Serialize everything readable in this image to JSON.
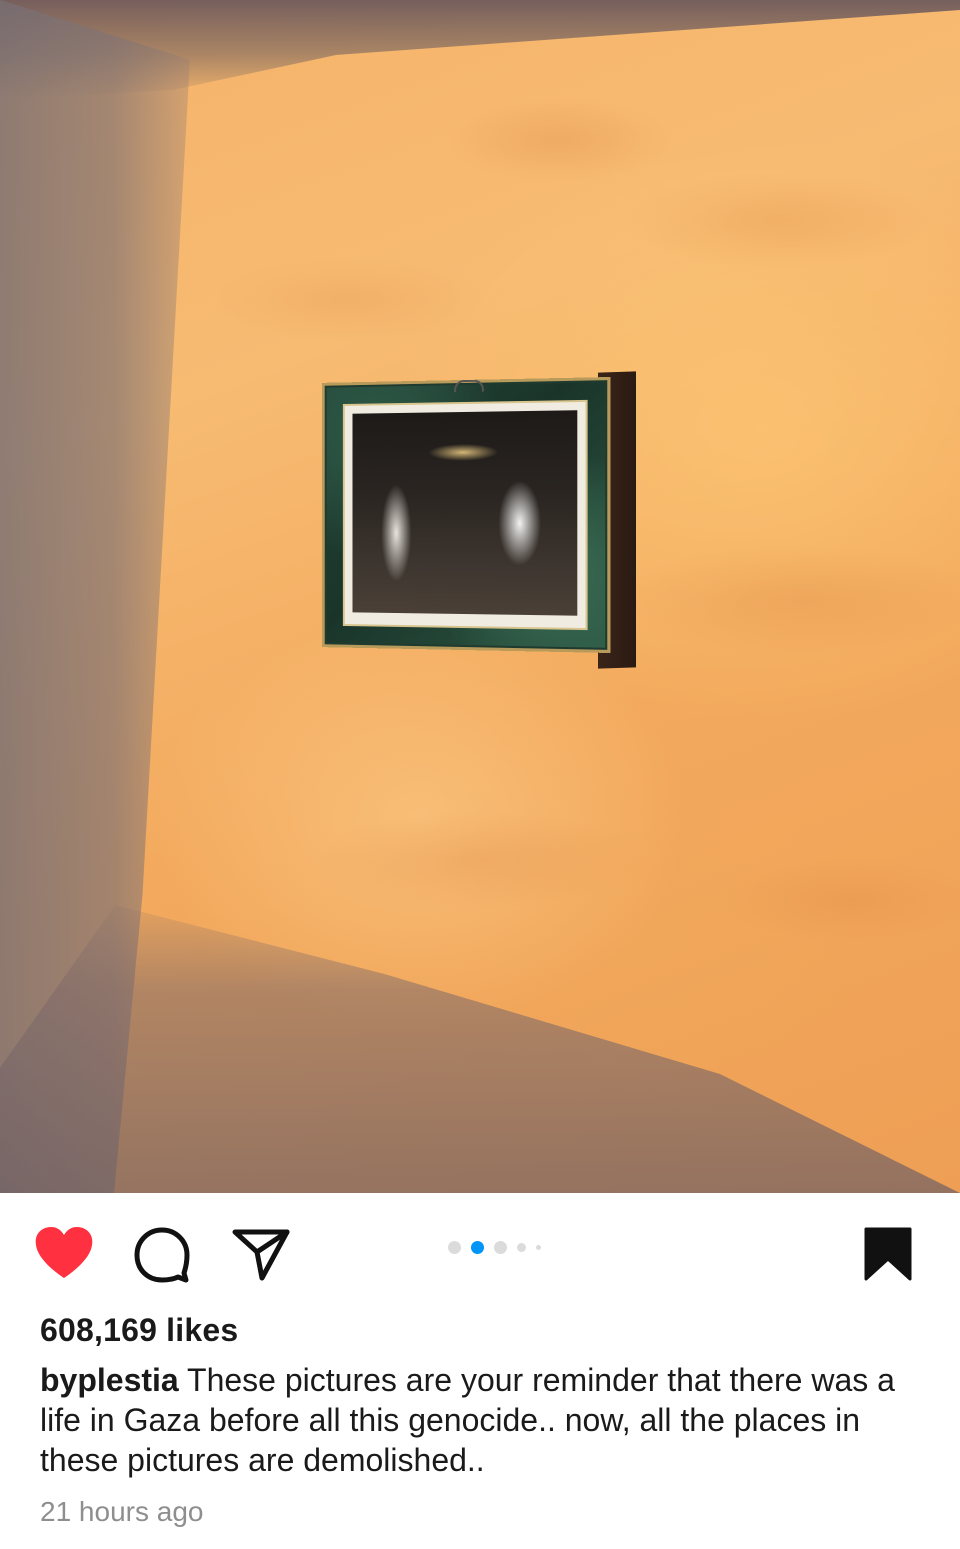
{
  "post": {
    "image_alt_icon": "framed-photo",
    "carousel": {
      "total": 5,
      "active_index": 1
    },
    "actions": {
      "like_icon": "heart-filled-icon",
      "comment_icon": "comment-icon",
      "share_icon": "share-paper-plane-icon",
      "save_icon": "bookmark-filled-icon",
      "like_color": "#ff3040"
    },
    "likes_text": "608,169 likes",
    "caption": {
      "username": "byplestia",
      "text": "These pictures are your reminder that there was a life in Gaza before all this genocide.. now, all the places in these pictures are demolished.."
    },
    "timestamp": "21 hours ago"
  },
  "colors": {
    "accent": "#0095f6",
    "like": "#ff3040",
    "text_primary": "#1a1a1a",
    "text_secondary": "#8e8e8e"
  }
}
